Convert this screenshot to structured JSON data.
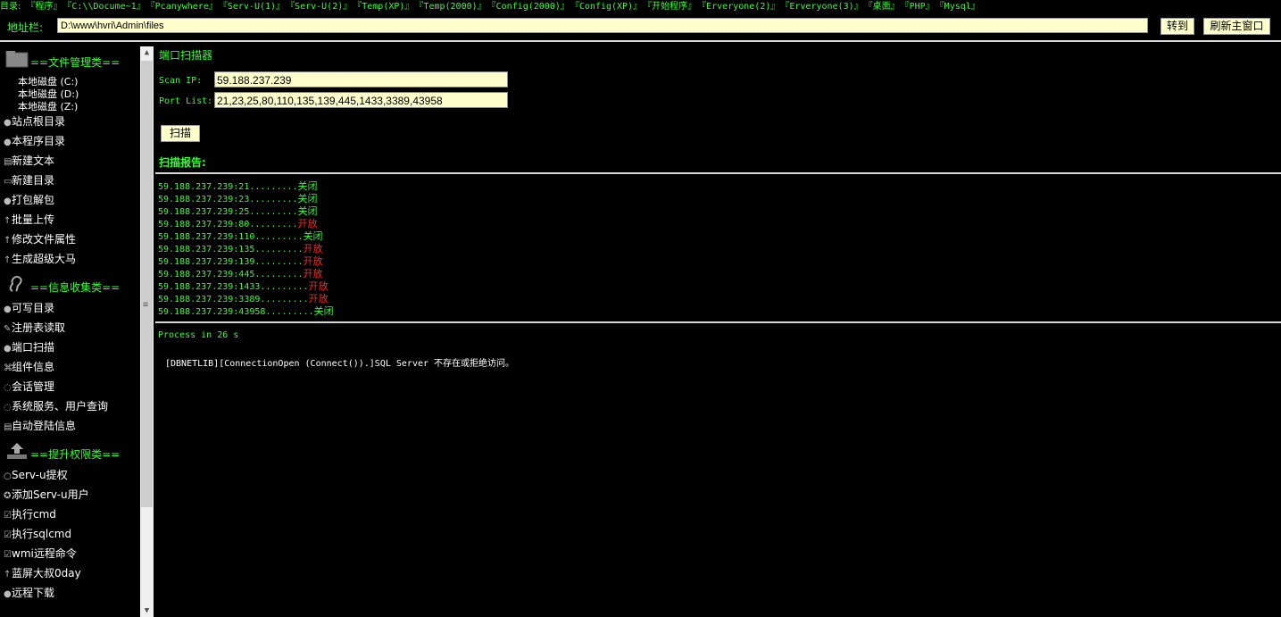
{
  "topbar": {
    "label": "目录:",
    "items": [
      "『程序』",
      "『C:\\\\Docume~1』",
      "『Pcanywhere』",
      "『Serv-U(1)』",
      "『Serv-U(2)』",
      "『Temp(XP)』",
      "『Temp(2000)』",
      "『Config(2000)』",
      "『Config(XP)』",
      "『开始程序』",
      "『Erveryone(2)』",
      "『Erveryone(3)』",
      "『桌面』",
      "『PHP』",
      "『Mysql』"
    ]
  },
  "address": {
    "label": "地址栏:",
    "value": "D:\\www\\hvri\\Admin\\files",
    "goto_label": "转到",
    "refresh_label": "刷新主窗口"
  },
  "sidebar": {
    "sections": {
      "file": "==文件管理类==",
      "info": "==信息收集类==",
      "priv": "==提升权限类=="
    },
    "drives": [
      "本地磁盘 (C:)",
      "本地磁盘 (D:)",
      "本地磁盘 (Z:)"
    ],
    "file_items": [
      "站点根目录",
      "本程序目录",
      "新建文本",
      "新建目录",
      "打包解包",
      "批量上传",
      "修改文件属性",
      "生成超级大马"
    ],
    "info_items": [
      "可写目录",
      "注册表读取",
      "端口扫描",
      "组件信息",
      "会话管理",
      "系统服务、用户查询",
      "自动登陆信息"
    ],
    "priv_items": [
      "Serv-u提权",
      "添加Serv-u用户",
      "执行cmd",
      "执行sqlcmd",
      "wmi远程命令",
      "蓝屏大叔0day",
      "远程下载"
    ]
  },
  "scanner": {
    "title": "端口扫描器",
    "ip_label": "Scan IP:",
    "ip_value": "59.188.237.239",
    "port_label": "Port List:",
    "port_value": "21,23,25,80,110,135,139,445,1433,3389,43958",
    "scan_label": "扫描",
    "report_title": "扫描报告:",
    "results": [
      {
        "addr": "59.188.237.239:21.........",
        "status": "关闭",
        "open": false
      },
      {
        "addr": "59.188.237.239:23.........",
        "status": "关闭",
        "open": false
      },
      {
        "addr": "59.188.237.239:25.........",
        "status": "关闭",
        "open": false
      },
      {
        "addr": "59.188.237.239:80.........",
        "status": "开放",
        "open": true
      },
      {
        "addr": "59.188.237.239:110.........",
        "status": "关闭",
        "open": false
      },
      {
        "addr": "59.188.237.239:135.........",
        "status": "开放",
        "open": true
      },
      {
        "addr": "59.188.237.239:139.........",
        "status": "开放",
        "open": true
      },
      {
        "addr": "59.188.237.239:445.........",
        "status": "开放",
        "open": true
      },
      {
        "addr": "59.188.237.239:1433.........",
        "status": "开放",
        "open": true
      },
      {
        "addr": "59.188.237.239:3389.........",
        "status": "开放",
        "open": true
      },
      {
        "addr": "59.188.237.239:43958.........",
        "status": "关闭",
        "open": false
      }
    ],
    "process_text": "Process in 26 s",
    "sql_error": "[DBNETLIB][ConnectionOpen (Connect()).]SQL Server 不存在或拒绝访问。"
  },
  "colors": {
    "accent_green": "#33ff33",
    "open_red": "#ff2222",
    "input_bg": "#ffffcc"
  }
}
